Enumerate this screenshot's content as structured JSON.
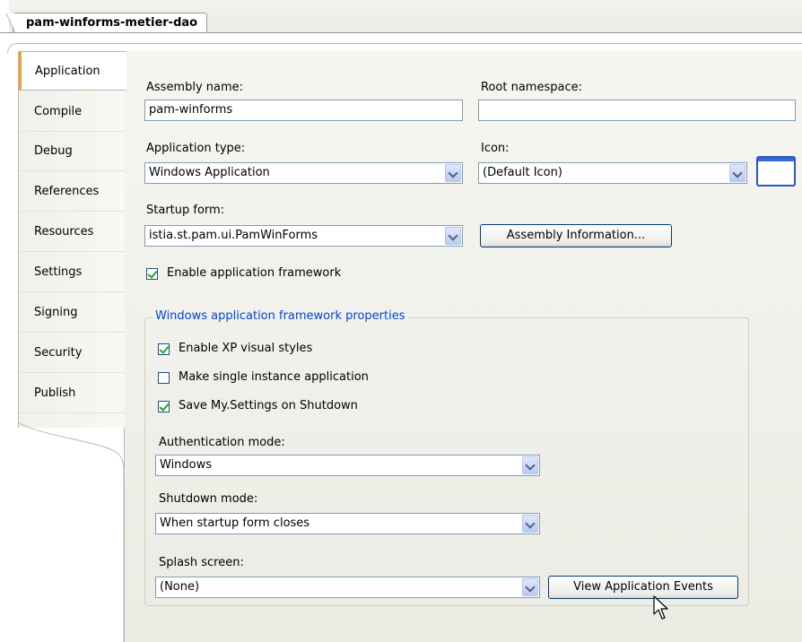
{
  "document_tab": {
    "label": "pam-winforms-metier-dao"
  },
  "sidebar": {
    "items": [
      {
        "label": "Application",
        "active": true
      },
      {
        "label": "Compile"
      },
      {
        "label": "Debug"
      },
      {
        "label": "References"
      },
      {
        "label": "Resources"
      },
      {
        "label": "Settings"
      },
      {
        "label": "Signing"
      },
      {
        "label": "Security"
      },
      {
        "label": "Publish"
      }
    ]
  },
  "form": {
    "assembly_name_label": "Assembly name:",
    "assembly_name_value": "pam-winforms",
    "root_namespace_label": "Root namespace:",
    "root_namespace_value": "",
    "application_type_label": "Application type:",
    "application_type_value": "Windows Application",
    "icon_label": "Icon:",
    "icon_value": "(Default Icon)",
    "startup_form_label": "Startup form:",
    "startup_form_value": "istia.st.pam.ui.PamWinForms",
    "assembly_info_button": "Assembly Information...",
    "enable_framework_label": "Enable application framework",
    "enable_framework_checked": true
  },
  "framework_group": {
    "title": "Windows application framework properties",
    "xp_styles_label": "Enable XP visual styles",
    "xp_styles_checked": true,
    "single_instance_label": "Make single instance application",
    "single_instance_checked": false,
    "save_settings_label": "Save My.Settings on Shutdown",
    "save_settings_checked": true,
    "auth_mode_label": "Authentication mode:",
    "auth_mode_value": "Windows",
    "shutdown_mode_label": "Shutdown mode:",
    "shutdown_mode_value": "When startup form closes",
    "splash_label": "Splash screen:",
    "splash_value": "(None)",
    "view_events_button": "View Application Events"
  },
  "colors": {
    "accent_tab": "#f0a030",
    "group_title": "#0046d5",
    "check_mark": "#21a121"
  }
}
